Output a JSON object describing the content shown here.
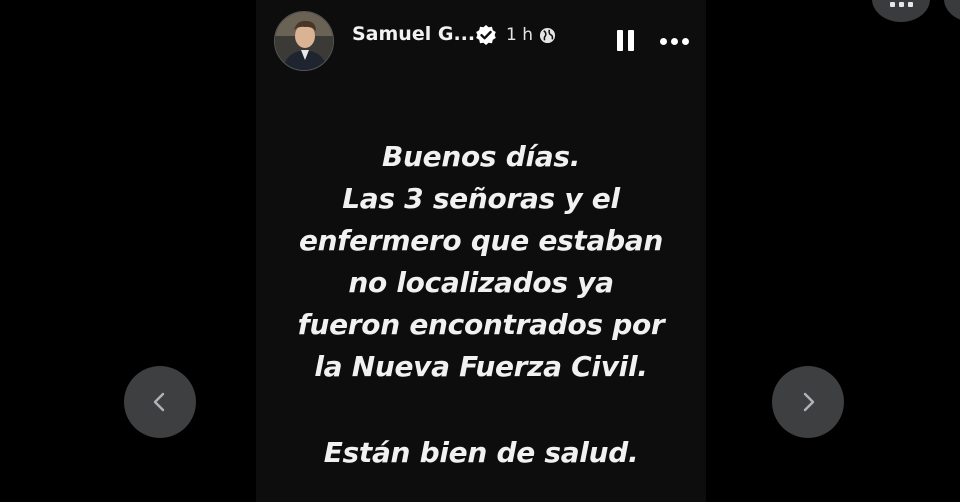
{
  "story": {
    "author": "Samuel G...",
    "time": "1 h",
    "lines": [
      "Buenos días.",
      "Las 3 señoras y el",
      "enfermero que estaban",
      "no localizados ya",
      "fueron encontrados por",
      "la Nueva Fuerza Civil."
    ],
    "closing": "Están bien de salud."
  },
  "icons": {
    "verified": "verified-badge-icon",
    "audience": "globe-icon",
    "pause": "pause-icon",
    "more": "more-options-icon",
    "prev": "chevron-left-icon",
    "next": "chevron-right-icon",
    "menu": "grid-menu-icon"
  },
  "colors": {
    "background": "#000000",
    "story_bg": "#0d0d0d",
    "nav_button": "#3e3f41",
    "text": "#f1f1f1"
  }
}
